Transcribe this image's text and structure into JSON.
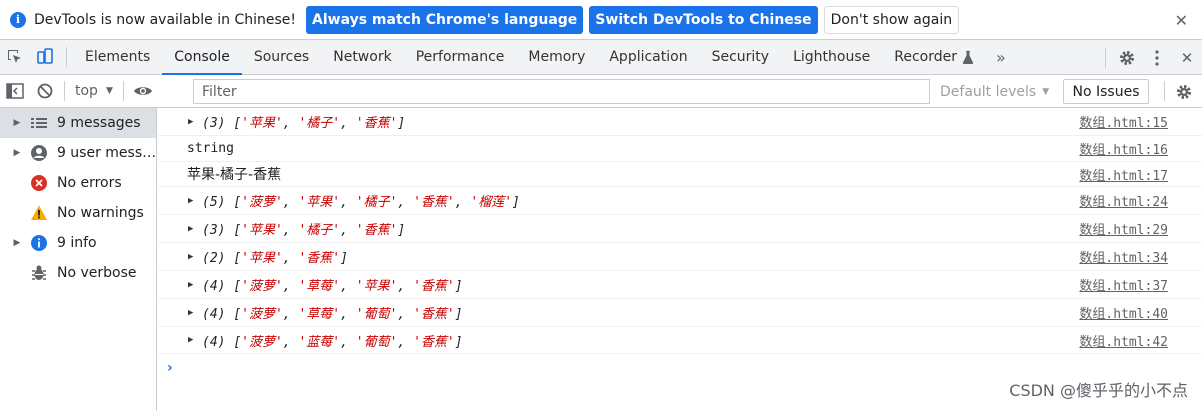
{
  "infobar": {
    "text": "DevTools is now available in Chinese!",
    "btn_match": "Always match Chrome's language",
    "btn_switch": "Switch DevTools to Chinese",
    "btn_dont_show": "Don't show again",
    "close": "✕"
  },
  "tabs": [
    "Elements",
    "Console",
    "Sources",
    "Network",
    "Performance",
    "Memory",
    "Application",
    "Security",
    "Lighthouse",
    "Recorder"
  ],
  "active_tab": "Console",
  "more_tabs": "»",
  "toolbar": {
    "context": "top",
    "filter_placeholder": "Filter",
    "levels": "Default levels",
    "issues": "No Issues"
  },
  "sidebar": [
    {
      "label": "9 messages",
      "icon": "list-icon",
      "expandable": true,
      "selected": true
    },
    {
      "label": "9 user mess…",
      "icon": "user-icon",
      "expandable": true,
      "selected": false
    },
    {
      "label": "No errors",
      "icon": "error-icon",
      "expandable": false,
      "selected": false
    },
    {
      "label": "No warnings",
      "icon": "warning-icon",
      "expandable": false,
      "selected": false
    },
    {
      "label": "9 info",
      "icon": "info-icon",
      "expandable": true,
      "selected": false
    },
    {
      "label": "No verbose",
      "icon": "bug-icon",
      "expandable": false,
      "selected": false
    }
  ],
  "messages": [
    {
      "type": "array",
      "count": "(3)",
      "items": [
        "苹果",
        "橘子",
        "香蕉"
      ],
      "source": "数组.html:15"
    },
    {
      "type": "plain",
      "text": "string",
      "cn": false,
      "source": "数组.html:16"
    },
    {
      "type": "plain",
      "text": "苹果-橘子-香蕉",
      "cn": true,
      "source": "数组.html:17"
    },
    {
      "type": "array",
      "count": "(5)",
      "items": [
        "菠萝",
        "苹果",
        "橘子",
        "香蕉",
        "榴莲"
      ],
      "source": "数组.html:24"
    },
    {
      "type": "array",
      "count": "(3)",
      "items": [
        "苹果",
        "橘子",
        "香蕉"
      ],
      "source": "数组.html:29"
    },
    {
      "type": "array",
      "count": "(2)",
      "items": [
        "苹果",
        "香蕉"
      ],
      "source": "数组.html:34"
    },
    {
      "type": "array",
      "count": "(4)",
      "items": [
        "菠萝",
        "草莓",
        "苹果",
        "香蕉"
      ],
      "source": "数组.html:37"
    },
    {
      "type": "array",
      "count": "(4)",
      "items": [
        "菠萝",
        "草莓",
        "葡萄",
        "香蕉"
      ],
      "source": "数组.html:40"
    },
    {
      "type": "array",
      "count": "(4)",
      "items": [
        "菠萝",
        "蓝莓",
        "葡萄",
        "香蕉"
      ],
      "source": "数组.html:42"
    }
  ],
  "prompt": "›",
  "watermark": "CSDN @傻乎乎的小不点",
  "colors": {
    "accent": "#1a73e8",
    "string": "#c80000",
    "error": "#d93025",
    "warning": "#f9ab00"
  }
}
